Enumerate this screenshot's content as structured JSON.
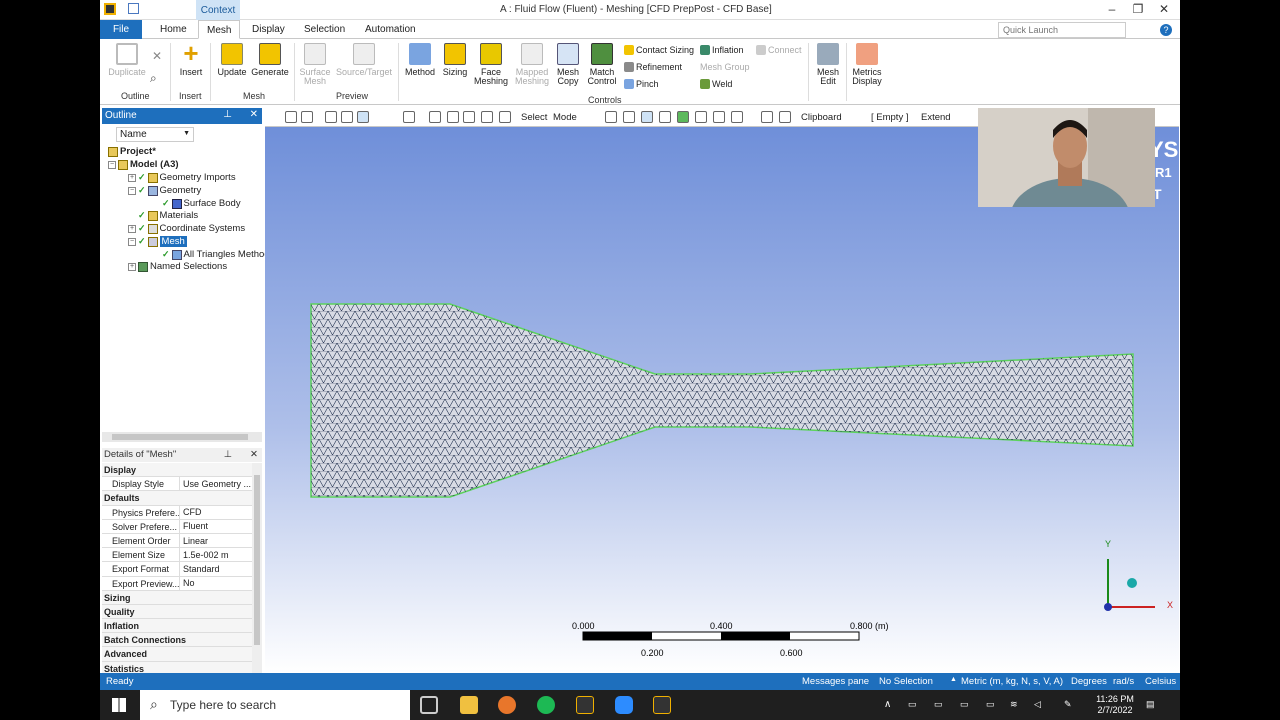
{
  "window": {
    "title": "A : Fluid Flow (Fluent) - Meshing [CFD PrepPost - CFD Base]",
    "context_tab": "Context",
    "quick_launch_placeholder": "Quick Launch"
  },
  "tabs": [
    "File",
    "Home",
    "Mesh",
    "Display",
    "Selection",
    "Automation"
  ],
  "ribbon": {
    "outline_group": {
      "duplicate": "Duplicate",
      "label": "Outline"
    },
    "insert_group": {
      "insert": "Insert",
      "label": "Insert"
    },
    "mesh_group": {
      "update": "Update",
      "generate": "Generate",
      "label": "Mesh"
    },
    "preview_group": {
      "surface_mesh": "Surface Mesh",
      "source_target": "Source/Target",
      "label": "Preview"
    },
    "controls_group": {
      "method": "Method",
      "sizing": "Sizing",
      "face_meshing": "Face Meshing",
      "mapped_meshing": "Mapped Meshing",
      "mesh_copy": "Mesh Copy",
      "match_control": "Match Control",
      "contact_sizing": "Contact Sizing",
      "refinement": "Refinement",
      "pinch": "Pinch",
      "inflation": "Inflation",
      "mesh_group_btn": "Mesh Group",
      "weld": "Weld",
      "connect": "Connect",
      "label": "Controls"
    },
    "mesh_edit": "Mesh Edit",
    "metrics_display": "Metrics Display"
  },
  "outline": {
    "header": "Outline",
    "name_filter": "Name",
    "tree": [
      "Project*",
      "Model (A3)",
      "Geometry Imports",
      "Geometry",
      "Surface Body",
      "Materials",
      "Coordinate Systems",
      "Mesh",
      "All Triangles Method",
      "Named Selections"
    ]
  },
  "details": {
    "header": "Details of \"Mesh\"",
    "rows": [
      {
        "k": "Display",
        "v": "",
        "cat": true
      },
      {
        "k": "Display Style",
        "v": "Use Geometry ..."
      },
      {
        "k": "Defaults",
        "v": "",
        "cat": true
      },
      {
        "k": "Physics Prefere...",
        "v": "CFD"
      },
      {
        "k": "Solver Prefere...",
        "v": "Fluent"
      },
      {
        "k": "Element Order",
        "v": "Linear"
      },
      {
        "k": "Element Size",
        "v": "1.5e-002 m"
      },
      {
        "k": "Export Format",
        "v": "Standard"
      },
      {
        "k": "Export Preview...",
        "v": "No"
      },
      {
        "k": "Sizing",
        "v": "",
        "cat": true
      },
      {
        "k": "Quality",
        "v": "",
        "cat": true
      },
      {
        "k": "Inflation",
        "v": "",
        "cat": true
      },
      {
        "k": "Batch Connections",
        "v": "",
        "cat": true
      },
      {
        "k": "Advanced",
        "v": "",
        "cat": true
      },
      {
        "k": "Statistics",
        "v": "",
        "cat": true
      }
    ]
  },
  "viewtoolbar": {
    "select": "Select",
    "mode": "Mode",
    "clipboard": "Clipboard",
    "empty": "[ Empty ]",
    "extend": "Extend"
  },
  "scale": {
    "t0": "0.000",
    "t1": "0.400",
    "t2": "0.800 (m)",
    "b1": "0.200",
    "b2": "0.600"
  },
  "triad": {
    "x": "X",
    "y": "Y"
  },
  "watermark": {
    "line1": "YS",
    "line2": "R1",
    "line3": "T"
  },
  "status": {
    "ready": "Ready",
    "messages": "Messages pane",
    "selection": "No Selection",
    "units": "Metric (m, kg, N, s, V, A)",
    "degrees": "Degrees",
    "rads": "rad/s",
    "temp": "Celsius"
  },
  "taskbar": {
    "search": "Type here to search",
    "time": "11:26 PM",
    "date": "2/7/2022"
  }
}
